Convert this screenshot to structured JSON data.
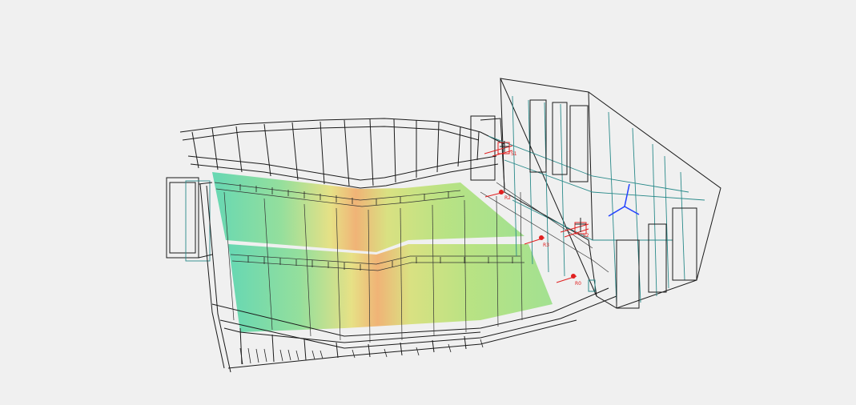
{
  "viewport": {
    "background": "#f0f0f0",
    "heatmap_colors": [
      "#5fd6b0",
      "#9de08a",
      "#e8e482",
      "#f0b070",
      "#b8e27c",
      "#70d8b0"
    ]
  },
  "markers": [
    {
      "label": "S1"
    },
    {
      "label": "S2"
    },
    {
      "label": "S3"
    },
    {
      "label": "R2"
    },
    {
      "label": "R3"
    },
    {
      "label": "R0"
    }
  ],
  "axes_gizmo": {
    "x_color": "#2040ff",
    "y_color": "#2040ff",
    "z_color": "#2040ff"
  }
}
